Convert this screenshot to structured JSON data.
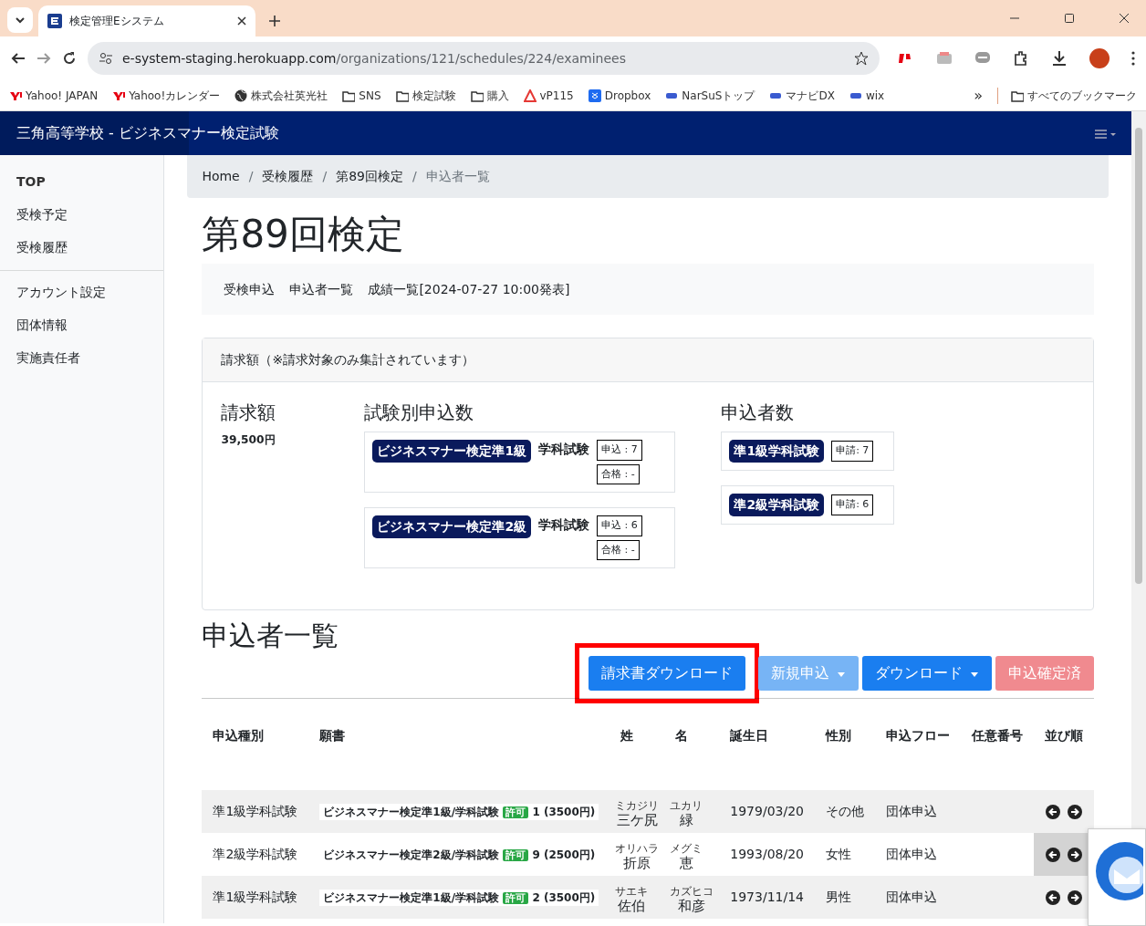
{
  "browser": {
    "tab_title": "検定管理Eシステム",
    "url_host": "e-system-staging.herokuapp.com",
    "url_path": "/organizations/121/schedules/224/examinees",
    "bookmarks": [
      {
        "label": "Yahoo! JAPAN",
        "kind": "yahoo"
      },
      {
        "label": "Yahoo!カレンダー",
        "kind": "yahoo"
      },
      {
        "label": "株式会社英光社",
        "kind": "globe"
      },
      {
        "label": "SNS",
        "kind": "folder"
      },
      {
        "label": "検定試験",
        "kind": "folder"
      },
      {
        "label": "購入",
        "kind": "folder"
      },
      {
        "label": "vP115",
        "kind": "triangle"
      },
      {
        "label": "Dropbox",
        "kind": "box"
      },
      {
        "label": "NarSuSトップ",
        "kind": "mark"
      },
      {
        "label": "マナビDX",
        "kind": "mark"
      },
      {
        "label": "wix",
        "kind": "mark"
      }
    ],
    "overflow": "»",
    "all_bookmarks": "すべてのブックマーク"
  },
  "navbar": {
    "title": "三角高等学校 - ビジネスマナー検定試験"
  },
  "sidebar": {
    "groups": [
      [
        {
          "label": "TOP",
          "bold": true
        },
        {
          "label": "受検予定",
          "bold": false
        },
        {
          "label": "受検履歴",
          "bold": false
        }
      ],
      [
        {
          "label": "アカウント設定",
          "bold": false
        },
        {
          "label": "団体情報",
          "bold": false
        },
        {
          "label": "実施責任者",
          "bold": false
        }
      ]
    ]
  },
  "breadcrumb": {
    "separator": "/",
    "items": [
      {
        "label": "Home",
        "kind": "link"
      },
      {
        "label": "受検履歴",
        "kind": "link"
      },
      {
        "label": "第89回検定",
        "kind": "link"
      },
      {
        "label": "申込者一覧",
        "kind": "current"
      }
    ]
  },
  "title": "第89回検定",
  "subnav": [
    "受検申込",
    "申込者一覧",
    "成績一覧[2024-07-27 10:00発表]"
  ],
  "billing": {
    "header": "請求額（※請求対象のみ集計されています）",
    "amount_heading": "請求額",
    "amount": "39,500円",
    "exams_heading": "試験別申込数",
    "exams": [
      {
        "badge": "ビジネスマナー検定準1級",
        "subject": "学科試験",
        "applied": "申込 : 7",
        "passed": "合格 : -"
      },
      {
        "badge": "ビジネスマナー検定準2級",
        "subject": "学科試験",
        "applied": "申込 : 6",
        "passed": "合格 : -"
      }
    ],
    "applicants_heading": "申込者数",
    "applicants": [
      {
        "badge": "準1級学科試験",
        "count": "申請: 7"
      },
      {
        "badge": "準2級学科試験",
        "count": "申請: 6"
      }
    ]
  },
  "section_title": "申込者一覧",
  "actions": [
    {
      "label": "請求書ダウンロード",
      "kind": "primary",
      "dropdown": false,
      "highlighted": true
    },
    {
      "label": "新規申込",
      "kind": "light",
      "dropdown": true,
      "highlighted": false
    },
    {
      "label": "ダウンロード",
      "kind": "primary",
      "dropdown": true,
      "highlighted": false
    },
    {
      "label": "申込確定済",
      "kind": "danger",
      "dropdown": false,
      "highlighted": false
    }
  ],
  "table": {
    "columns": [
      "申込種別",
      "願書",
      "姓",
      "名",
      "誕生日",
      "性別",
      "申込フロー",
      "任意番号",
      "並び順"
    ],
    "rows": [
      {
        "type": "準1級学科試験",
        "form": "ビジネスマナー検定準1級/学科試験",
        "status": "許可",
        "fee": "1 (3500円)",
        "surname": "三ケ尻",
        "surname_kana": "ミカジリ",
        "given": "緑",
        "given_kana": "ユカリ",
        "birthday": "1979/03/20",
        "gender": "その他",
        "flow": "団体申込"
      },
      {
        "type": "準2級学科試験",
        "form": "ビジネスマナー検定準2級/学科試験",
        "status": "許可",
        "fee": "9 (2500円)",
        "surname": "折原",
        "surname_kana": "オリハラ",
        "given": "恵",
        "given_kana": "メグミ",
        "birthday": "1993/08/20",
        "gender": "女性",
        "flow": "団体申込"
      },
      {
        "type": "準1級学科試験",
        "form": "ビジネスマナー検定準1級/学科試験",
        "status": "許可",
        "fee": "2 (3500円)",
        "surname": "佐伯",
        "surname_kana": "サエキ",
        "given": "和彦",
        "given_kana": "カズヒコ",
        "birthday": "1973/11/14",
        "gender": "男性",
        "flow": "団体申込"
      }
    ]
  }
}
